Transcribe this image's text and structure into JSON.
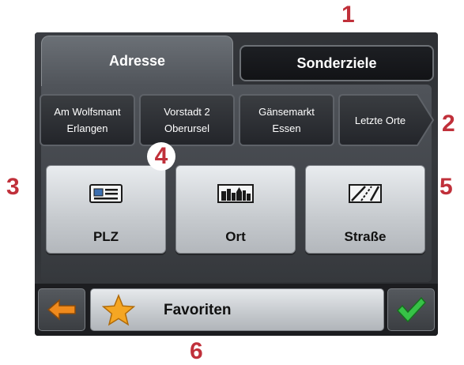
{
  "callouts": [
    "1",
    "2",
    "3",
    "4",
    "5",
    "6"
  ],
  "tabs": [
    {
      "label": "Adresse",
      "active": true
    },
    {
      "label": "Sonderziele",
      "active": false
    }
  ],
  "recent": [
    {
      "line1": "Am Wolfsmant",
      "line2": "Erlangen"
    },
    {
      "line1": "Vorstadt 2",
      "line2": "Oberursel"
    },
    {
      "line1": "Gänsemarkt",
      "line2": "Essen"
    }
  ],
  "recent_more": "Letzte Orte",
  "buttons": [
    {
      "label": "PLZ",
      "icon": "id-card-icon"
    },
    {
      "label": "Ort",
      "icon": "city-skyline-icon"
    },
    {
      "label": "Straße",
      "icon": "road-icon"
    }
  ],
  "bottom": {
    "back_icon": "arrow-left-icon",
    "favorites_label": "Favoriten",
    "favorites_icon": "star-icon",
    "confirm_icon": "checkmark-icon"
  },
  "colors": {
    "callout": "#c0303a",
    "star": "#f5a623",
    "check": "#37c247",
    "back_arrow": "#f08a1c"
  }
}
